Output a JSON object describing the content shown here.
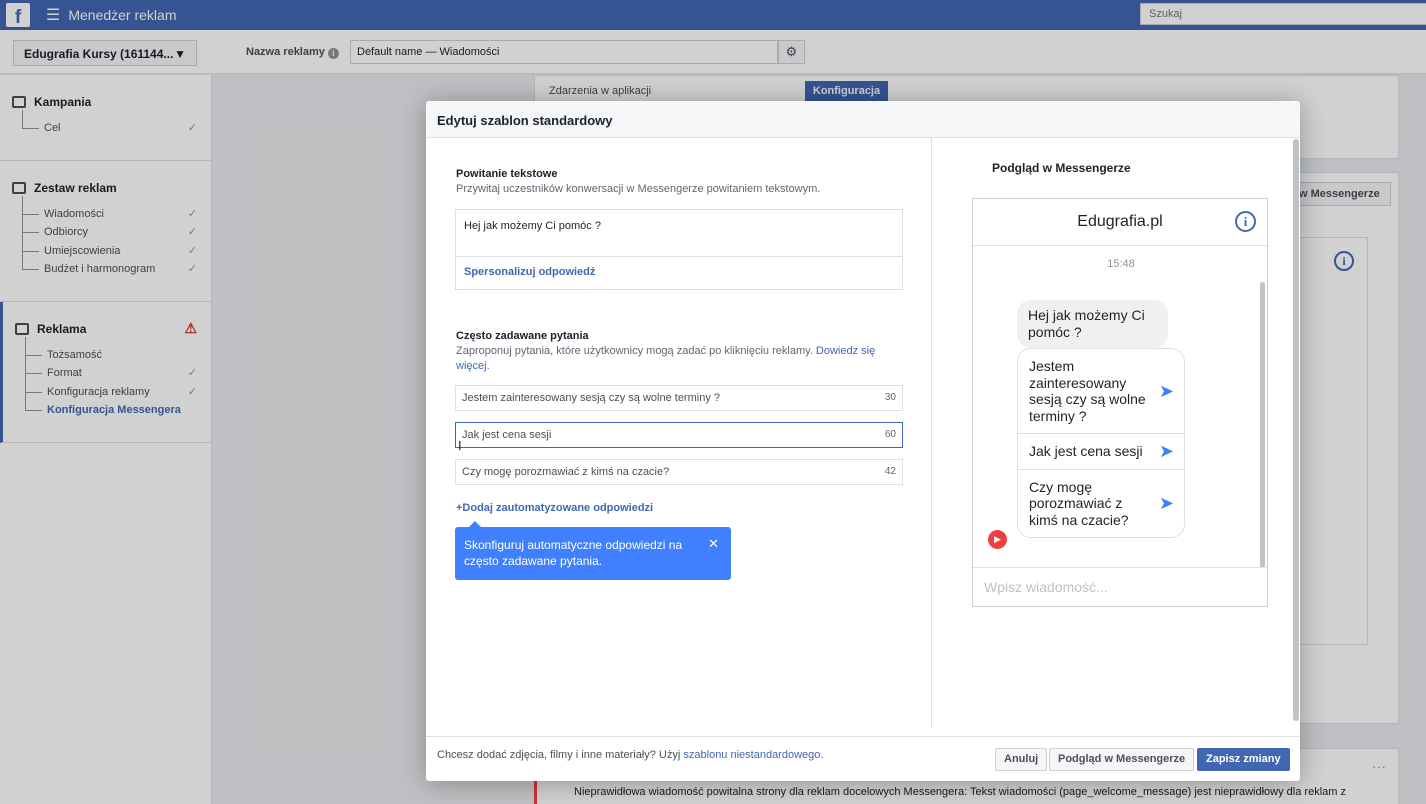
{
  "topbar": {
    "logo": "f",
    "menu_icon": "☰",
    "title": "Menedżer reklam",
    "search_placeholder": "Szukaj"
  },
  "subbar": {
    "account": "Edugrafia Kursy (161144...",
    "ad_name_label": "Nazwa reklamy",
    "ad_name_value": "Default name — Wiadomości"
  },
  "sidebar": {
    "campaign": {
      "title": "Kampania",
      "items": [
        {
          "label": "Cel",
          "done": "✓"
        }
      ]
    },
    "adset": {
      "title": "Zestaw reklam",
      "items": [
        {
          "label": "Wiadomości",
          "done": "✓"
        },
        {
          "label": "Odbiorcy",
          "done": "✓"
        },
        {
          "label": "Umiejscowienia",
          "done": "✓"
        },
        {
          "label": "Budżet i harmonogram",
          "done": "✓"
        }
      ]
    },
    "ad": {
      "title": "Reklama",
      "warning": "⚠",
      "items": [
        {
          "label": "Tożsamość",
          "done": ""
        },
        {
          "label": "Format",
          "done": "✓"
        },
        {
          "label": "Konfiguracja reklamy",
          "done": "✓"
        },
        {
          "label": "Konfiguracja Messengera",
          "done": ""
        }
      ]
    }
  },
  "background": {
    "app_events_label": "Zdarzenia w aplikacji",
    "config_button": "Konfiguracja",
    "messenger_preview_button": "w Messengerze",
    "error_text": "Nieprawidłowa wiadomość powitalna strony dla reklam docelowych Messengera: Tekst wiadomości (page_welcome_message) jest nieprawidłowy dla reklam z",
    "dots": "···"
  },
  "modal": {
    "title": "Edytuj szablon standardowy",
    "welcome": {
      "title": "Powitanie tekstowe",
      "subtitle": "Przywitaj uczestników konwersacji w Messengerze powitaniem tekstowym.",
      "text": "Hej jak możemy Ci pomóc ?",
      "personalize": "Spersonalizuj odpowiedź"
    },
    "faq": {
      "title": "Często zadawane pytania",
      "subtitle": "Zaproponuj pytania, które użytkownicy mogą zadać po kliknięciu reklamy.",
      "learn_more": "Dowiedz się więcej.",
      "questions": [
        {
          "text": "Jestem zainteresowany sesją czy są wolne terminy ?",
          "count": "30"
        },
        {
          "text": "Jak jest cena sesji",
          "count": "60"
        },
        {
          "text": "Czy mogę porozmawiać z kimś na czacie?",
          "count": "42"
        }
      ],
      "add_auto": "+Dodaj zautomatyzowane odpowiedzi",
      "tooltip": "Skonfiguruj automatyczne odpowiedzi na często zadawane pytania."
    },
    "preview": {
      "title": "Podgląd w Messengerze",
      "page_name": "Edugrafia.pl",
      "time": "15:48",
      "welcome_bubble": "Hej jak możemy Ci pomóc ?",
      "quick_replies": [
        "Jestem zainteresowany sesją czy są wolne terminy ?",
        "Jak jest cena sesji",
        "Czy mogę porozmawiać z kimś na czacie?"
      ],
      "input_placeholder": "Wpisz wiadomość..."
    },
    "footer": {
      "text_before": "Chcesz dodać zdjęcia, filmy i inne materiały? Użyj",
      "link": "szablonu niestandardowego",
      "text_after": ".",
      "cancel": "Anuluj",
      "preview": "Podgląd w Messengerze",
      "save": "Zapisz zmiany"
    }
  }
}
